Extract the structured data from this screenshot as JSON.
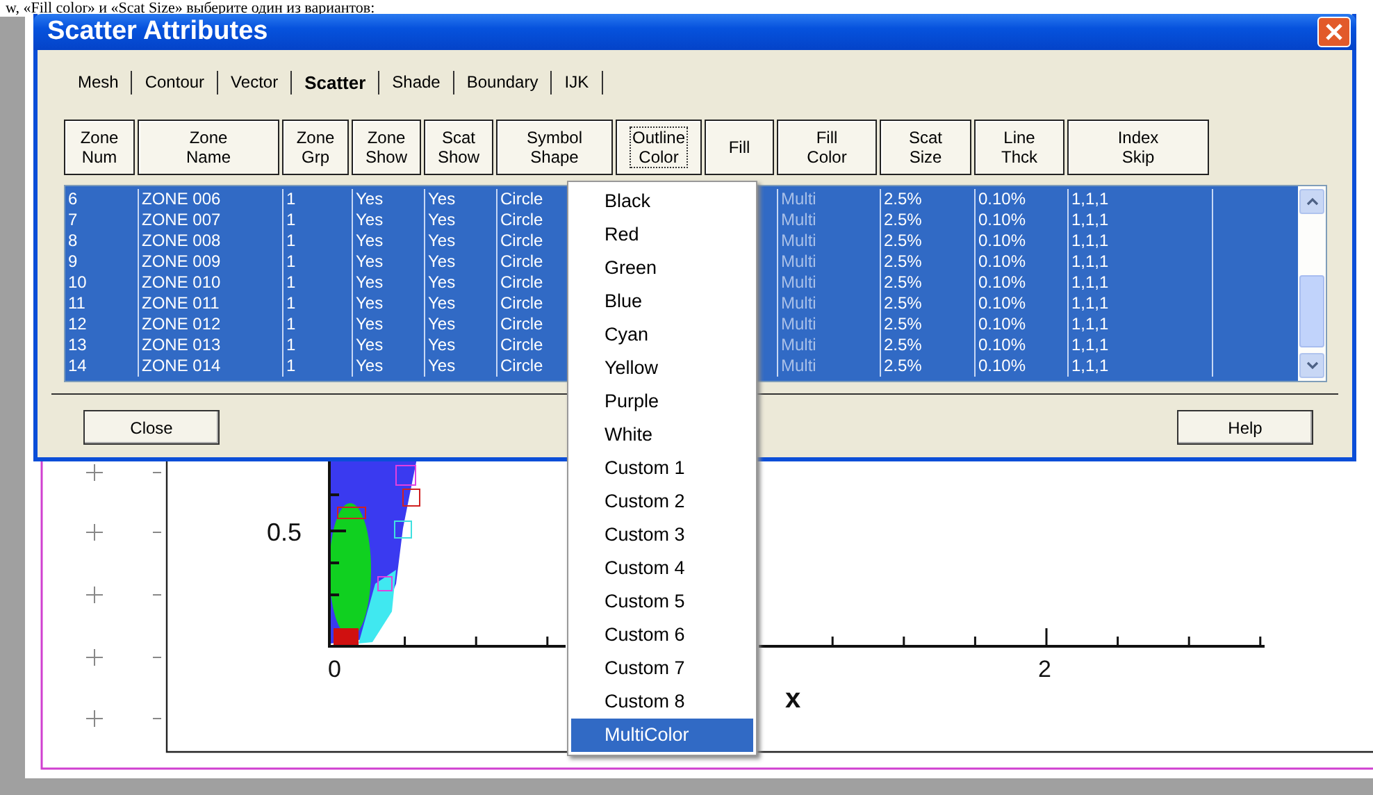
{
  "document_text": "w, «Fill color» и «Scat Size» выберите один из вариантов:",
  "dialog": {
    "title": "Scatter Attributes",
    "tabs": [
      {
        "label": "Mesh",
        "selected": false
      },
      {
        "label": "Contour",
        "selected": false
      },
      {
        "label": "Vector",
        "selected": false
      },
      {
        "label": "Scatter",
        "selected": true
      },
      {
        "label": "Shade",
        "selected": false
      },
      {
        "label": "Boundary",
        "selected": false
      },
      {
        "label": "IJK",
        "selected": false
      }
    ],
    "columns": [
      {
        "label": "Zone\nNum",
        "focused": false
      },
      {
        "label": "Zone\nName",
        "focused": false
      },
      {
        "label": "Zone\nGrp",
        "focused": false
      },
      {
        "label": "Zone\nShow",
        "focused": false
      },
      {
        "label": "Scat\nShow",
        "focused": false
      },
      {
        "label": "Symbol\nShape",
        "focused": false
      },
      {
        "label": "Outline\nColor",
        "focused": true
      },
      {
        "label": "Fill",
        "focused": false
      },
      {
        "label": "Fill\nColor",
        "focused": false
      },
      {
        "label": "Scat\nSize",
        "focused": false
      },
      {
        "label": "Line\nThck",
        "focused": false
      },
      {
        "label": "Index\nSkip",
        "focused": false
      }
    ],
    "rows": [
      {
        "zone_num": "6",
        "zone_name": "ZONE 006",
        "zone_grp": "1",
        "zone_show": "Yes",
        "scat_show": "Yes",
        "symbol_shape": "Circle",
        "fill_color": "Multi",
        "scat_size": "2.5%",
        "line_thck": "0.10%",
        "index_skip": "1,1,1",
        "selected": true
      },
      {
        "zone_num": "7",
        "zone_name": "ZONE 007",
        "zone_grp": "1",
        "zone_show": "Yes",
        "scat_show": "Yes",
        "symbol_shape": "Circle",
        "fill_color": "Multi",
        "scat_size": "2.5%",
        "line_thck": "0.10%",
        "index_skip": "1,1,1",
        "selected": true
      },
      {
        "zone_num": "8",
        "zone_name": "ZONE 008",
        "zone_grp": "1",
        "zone_show": "Yes",
        "scat_show": "Yes",
        "symbol_shape": "Circle",
        "fill_color": "Multi",
        "scat_size": "2.5%",
        "line_thck": "0.10%",
        "index_skip": "1,1,1",
        "selected": true
      },
      {
        "zone_num": "9",
        "zone_name": "ZONE 009",
        "zone_grp": "1",
        "zone_show": "Yes",
        "scat_show": "Yes",
        "symbol_shape": "Circle",
        "fill_color": "Multi",
        "scat_size": "2.5%",
        "line_thck": "0.10%",
        "index_skip": "1,1,1",
        "selected": true
      },
      {
        "zone_num": "10",
        "zone_name": "ZONE 010",
        "zone_grp": "1",
        "zone_show": "Yes",
        "scat_show": "Yes",
        "symbol_shape": "Circle",
        "fill_color": "Multi",
        "scat_size": "2.5%",
        "line_thck": "0.10%",
        "index_skip": "1,1,1",
        "selected": true
      },
      {
        "zone_num": "11",
        "zone_name": "ZONE 011",
        "zone_grp": "1",
        "zone_show": "Yes",
        "scat_show": "Yes",
        "symbol_shape": "Circle",
        "fill_color": "Multi",
        "scat_size": "2.5%",
        "line_thck": "0.10%",
        "index_skip": "1,1,1",
        "selected": true
      },
      {
        "zone_num": "12",
        "zone_name": "ZONE 012",
        "zone_grp": "1",
        "zone_show": "Yes",
        "scat_show": "Yes",
        "symbol_shape": "Circle",
        "fill_color": "Multi",
        "scat_size": "2.5%",
        "line_thck": "0.10%",
        "index_skip": "1,1,1",
        "selected": true
      },
      {
        "zone_num": "13",
        "zone_name": "ZONE 013",
        "zone_grp": "1",
        "zone_show": "Yes",
        "scat_show": "Yes",
        "symbol_shape": "Circle",
        "fill_color": "Multi",
        "scat_size": "2.5%",
        "line_thck": "0.10%",
        "index_skip": "1,1,1",
        "selected": true
      },
      {
        "zone_num": "14",
        "zone_name": "ZONE 014",
        "zone_grp": "1",
        "zone_show": "Yes",
        "scat_show": "Yes",
        "symbol_shape": "Circle",
        "fill_color": "Multi",
        "scat_size": "2.5%",
        "line_thck": "0.10%",
        "index_skip": "1,1,1",
        "selected": true
      }
    ],
    "buttons": [
      {
        "label": "Close"
      },
      {
        "label": "Help"
      }
    ]
  },
  "dropdown": {
    "items": [
      {
        "label": "Black",
        "selected": false
      },
      {
        "label": "Red",
        "selected": false
      },
      {
        "label": "Green",
        "selected": false
      },
      {
        "label": "Blue",
        "selected": false
      },
      {
        "label": "Cyan",
        "selected": false
      },
      {
        "label": "Yellow",
        "selected": false
      },
      {
        "label": "Purple",
        "selected": false
      },
      {
        "label": "White",
        "selected": false
      },
      {
        "label": "Custom 1",
        "selected": false
      },
      {
        "label": "Custom 2",
        "selected": false
      },
      {
        "label": "Custom 3",
        "selected": false
      },
      {
        "label": "Custom 4",
        "selected": false
      },
      {
        "label": "Custom 5",
        "selected": false
      },
      {
        "label": "Custom 6",
        "selected": false
      },
      {
        "label": "Custom 7",
        "selected": false
      },
      {
        "label": "Custom 8",
        "selected": false
      },
      {
        "label": "MultiColor",
        "selected": true
      }
    ]
  },
  "plot": {
    "y_tick_label": "0.5",
    "x_tick_labels": [
      "0",
      "2"
    ],
    "x_axis_label": "x"
  }
}
